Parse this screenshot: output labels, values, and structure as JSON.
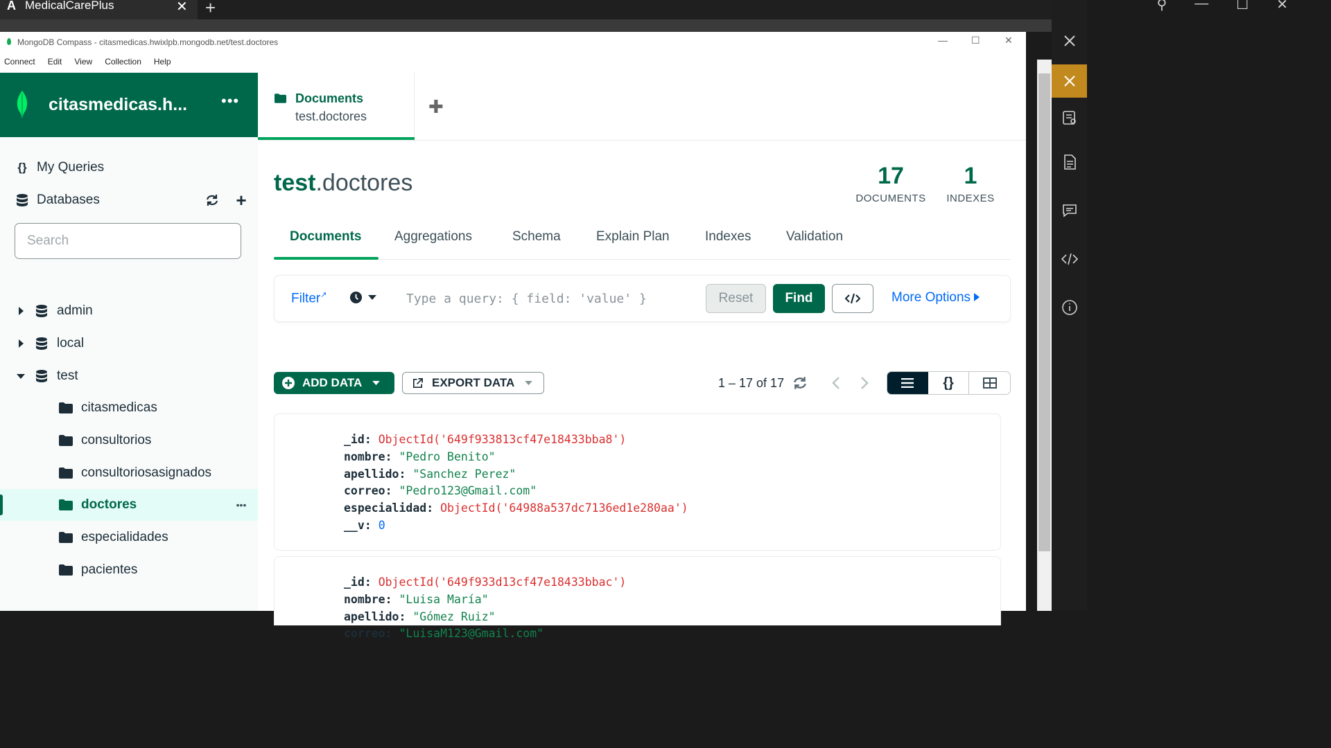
{
  "browser": {
    "tab_title": "MedicalCarePlus",
    "logo_letter": "A",
    "close_glyph": "✕",
    "new_tab_glyph": "+"
  },
  "window": {
    "title": "MongoDB Compass - citasmedicas.hwixlpb.mongodb.net/test.doctores",
    "menu": [
      "Connect",
      "Edit",
      "View",
      "Collection",
      "Help"
    ]
  },
  "sidebar": {
    "connection_name": "citasmedicas.h...",
    "my_queries": "My Queries",
    "databases": "Databases",
    "search_placeholder": "Search",
    "dbs": [
      {
        "name": "admin",
        "expanded": false
      },
      {
        "name": "local",
        "expanded": false
      },
      {
        "name": "test",
        "expanded": true
      }
    ],
    "collections": [
      "citasmedicas",
      "consultorios",
      "consultoriosasignados",
      "doctores",
      "especialidades",
      "pacientes"
    ],
    "selected_collection": "doctores"
  },
  "tab": {
    "label": "Documents",
    "namespace": "test.doctores"
  },
  "header": {
    "db": "test",
    "collection": ".doctores",
    "documents_count": "17",
    "documents_label": "DOCUMENTS",
    "indexes_count": "1",
    "indexes_label": "INDEXES"
  },
  "subtabs": [
    "Documents",
    "Aggregations",
    "Schema",
    "Explain Plan",
    "Indexes",
    "Validation"
  ],
  "query": {
    "filter_label": "Filter",
    "placeholder": "Type a query: { field: 'value' }",
    "reset_label": "Reset",
    "find_label": "Find",
    "more_options_label": "More Options"
  },
  "toolbar": {
    "add_data_label": "ADD DATA",
    "export_data_label": "EXPORT DATA",
    "pager_text": "1 – 17 of 17"
  },
  "documents": [
    {
      "_id": "ObjectId('649f933813cf47e18433bba8')",
      "nombre": "\"Pedro Benito\"",
      "apellido": "\"Sanchez Perez\"",
      "correo": "\"Pedro123@Gmail.com\"",
      "especialidad": "ObjectId('64988a537dc7136ed1e280aa')",
      "__v": "0"
    },
    {
      "_id": "ObjectId('649f933d13cf47e18433bbac')",
      "nombre": "\"Luisa María\"",
      "apellido": "\"Gómez Ruiz\"",
      "correo": "\"LuisaM123@Gmail.com\""
    }
  ],
  "colors": {
    "brand_green": "#00684a",
    "accent_green": "#00a35c",
    "link_blue": "#016bf8",
    "objectid_red": "#db3030",
    "string_green": "#12824d",
    "devtools_active": "#c28a1e"
  }
}
